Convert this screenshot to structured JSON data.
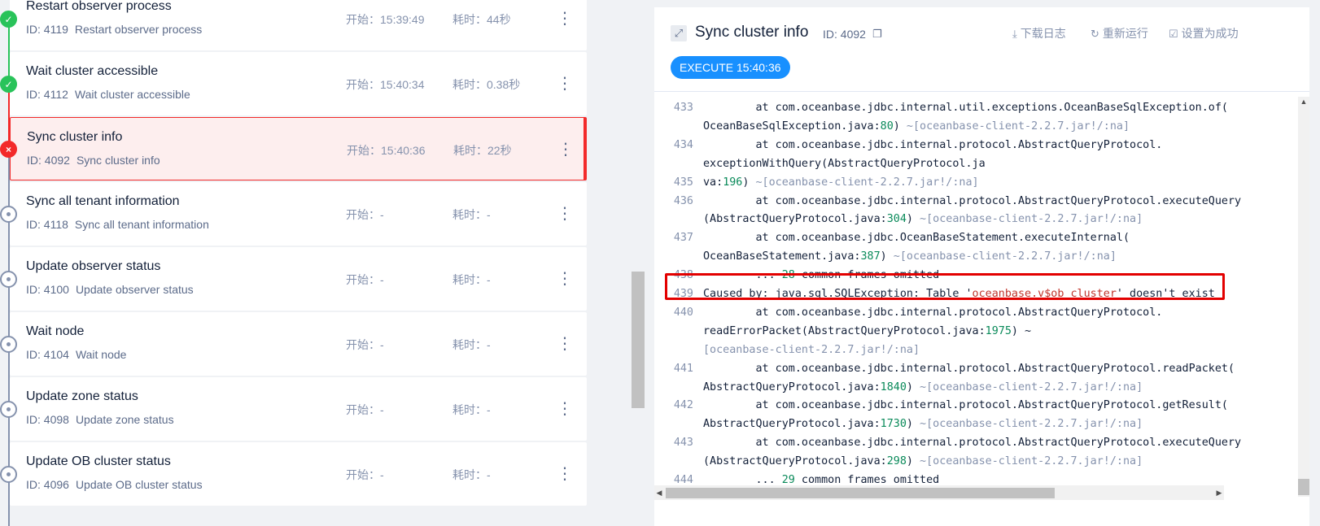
{
  "tasks": [
    {
      "name": "Restart observer process",
      "id_text": "ID: 4119",
      "desc": "Restart observer process",
      "start": "开始：15:39:49",
      "cost": "耗时：44秒",
      "status": "success"
    },
    {
      "name": "Wait cluster accessible",
      "id_text": "ID: 4112",
      "desc": "Wait cluster accessible",
      "start": "开始：15:40:34",
      "cost": "耗时：0.38秒",
      "status": "success"
    },
    {
      "name": "Sync cluster info",
      "id_text": "ID: 4092",
      "desc": "Sync cluster info",
      "start": "开始：15:40:36",
      "cost": "耗时：22秒",
      "status": "failed"
    },
    {
      "name": "Sync all tenant information",
      "id_text": "ID: 4118",
      "desc": "Sync all tenant information",
      "start": "开始：-",
      "cost": "耗时：-",
      "status": "pending"
    },
    {
      "name": "Update observer status",
      "id_text": "ID: 4100",
      "desc": "Update observer status",
      "start": "开始：-",
      "cost": "耗时：-",
      "status": "pending"
    },
    {
      "name": "Wait node",
      "id_text": "ID: 4104",
      "desc": "Wait node",
      "start": "开始：-",
      "cost": "耗时：-",
      "status": "pending"
    },
    {
      "name": "Update zone status",
      "id_text": "ID: 4098",
      "desc": "Update zone status",
      "start": "开始：-",
      "cost": "耗时：-",
      "status": "pending"
    },
    {
      "name": "Update OB cluster status",
      "id_text": "ID: 4096",
      "desc": "Update OB cluster status",
      "start": "开始：-",
      "cost": "耗时：-",
      "status": "pending"
    }
  ],
  "more_icon": "⋮",
  "log_panel": {
    "title": "Sync cluster info",
    "id_text": "ID: 4092",
    "actions": {
      "download": "下载日志",
      "rerun": "重新运行",
      "set_success": "设置为成功"
    },
    "exec_badge": "EXECUTE 15:40:36"
  },
  "log_lines": [
    {
      "n": "433",
      "t": "        at com.oceanbase.jdbc.internal.util.exceptions.OceanBaseSqlException.of("
    },
    {
      "n": "",
      "t": "OceanBaseSqlException.java:80) ~[oceanbase-client-2.2.7.jar!/:na]"
    },
    {
      "n": "434",
      "t": "        at com.oceanbase.jdbc.internal.protocol.AbstractQueryProtocol."
    },
    {
      "n": "",
      "t": "exceptionWithQuery(AbstractQueryProtocol.ja"
    },
    {
      "n": "435",
      "t": "va:196) ~[oceanbase-client-2.2.7.jar!/:na]"
    },
    {
      "n": "436",
      "t": "        at com.oceanbase.jdbc.internal.protocol.AbstractQueryProtocol.executeQuery"
    },
    {
      "n": "",
      "t": "(AbstractQueryProtocol.java:304) ~[oceanbase-client-2.2.7.jar!/:na]"
    },
    {
      "n": "437",
      "t": "        at com.oceanbase.jdbc.OceanBaseStatement.executeInternal("
    },
    {
      "n": "",
      "t": "OceanBaseStatement.java:387) ~[oceanbase-client-2.2.7.jar!/:na]"
    },
    {
      "n": "438",
      "t": "        ... 28 common frames omitted"
    },
    {
      "n": "439",
      "t": "Caused by: java.sql.SQLException: Table 'oceanbase.v$ob_cluster' doesn't exist"
    },
    {
      "n": "440",
      "t": "        at com.oceanbase.jdbc.internal.protocol.AbstractQueryProtocol."
    },
    {
      "n": "",
      "t": "readErrorPacket(AbstractQueryProtocol.java:1975) ~"
    },
    {
      "n": "",
      "t": "[oceanbase-client-2.2.7.jar!/:na]"
    },
    {
      "n": "441",
      "t": "        at com.oceanbase.jdbc.internal.protocol.AbstractQueryProtocol.readPacket("
    },
    {
      "n": "",
      "t": "AbstractQueryProtocol.java:1840) ~[oceanbase-client-2.2.7.jar!/:na]"
    },
    {
      "n": "442",
      "t": "        at com.oceanbase.jdbc.internal.protocol.AbstractQueryProtocol.getResult("
    },
    {
      "n": "",
      "t": "AbstractQueryProtocol.java:1730) ~[oceanbase-client-2.2.7.jar!/:na]"
    },
    {
      "n": "443",
      "t": "        at com.oceanbase.jdbc.internal.protocol.AbstractQueryProtocol.executeQuery"
    },
    {
      "n": "",
      "t": "(AbstractQueryProtocol.java:298) ~[oceanbase-client-2.2.7.jar!/:na]"
    },
    {
      "n": "444",
      "t": "        ... 29 common frames omitted"
    }
  ],
  "colors": {
    "success": "#29c35a",
    "error": "#f32a2a",
    "pending": "#8592ad",
    "accent": "#1890ff",
    "highlight_box": "#e30000"
  },
  "icons": {
    "expand": "expand-icon",
    "copy": "copy-icon",
    "download": "download-icon",
    "rerun": "refresh-icon",
    "set_success": "check-square-icon"
  }
}
